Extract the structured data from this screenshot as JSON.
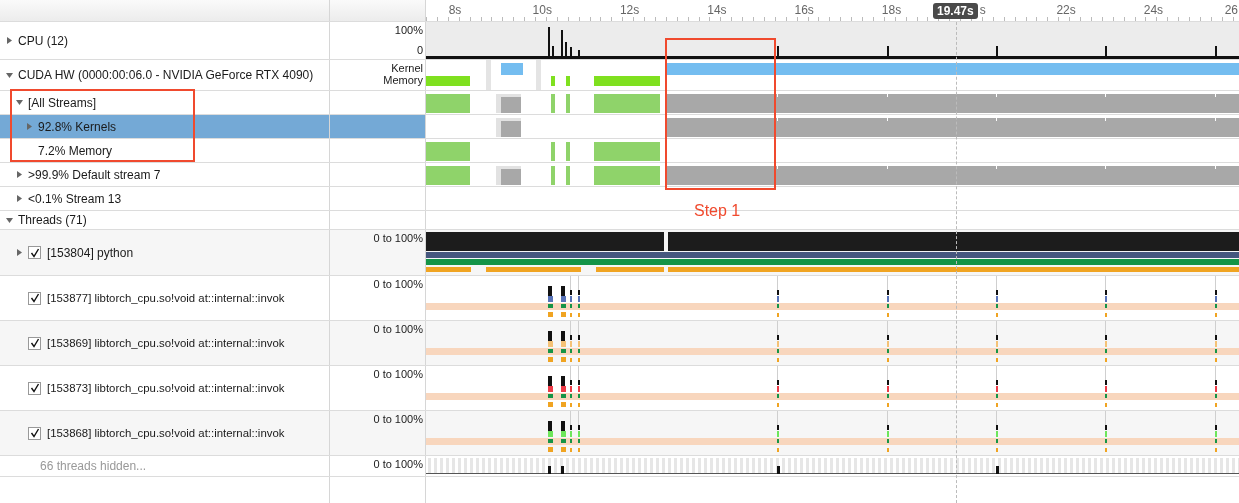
{
  "ruler": {
    "ticks": [
      "8s",
      "10s",
      "12s",
      "14s",
      "16s",
      "18s",
      "s",
      "22s",
      "24s",
      "26"
    ],
    "cursor": "19.47s"
  },
  "tree": [
    {
      "kind": "cpu",
      "label": "CPU (12)",
      "expanded": false,
      "selected": false,
      "scale": [
        "100%",
        "0"
      ]
    },
    {
      "kind": "gpu",
      "label": "CUDA HW (0000:00:06.0 - NVIDIA GeForce RTX 4090)",
      "expanded": true,
      "selected": false,
      "scale": [
        "Kernel",
        "Memory"
      ],
      "children": [
        {
          "kind": "stream",
          "label": "[All Streams]",
          "expanded": true,
          "selected": false,
          "children": [
            {
              "kind": "stream",
              "label": "92.8% Kernels",
              "expanded": false,
              "selected": true
            },
            {
              "kind": "stream",
              "label": "7.2% Memory",
              "selected": false
            }
          ]
        },
        {
          "kind": "stream",
          "label": ">99.9% Default stream 7",
          "expanded": false,
          "selected": false
        },
        {
          "kind": "stream",
          "label": "<0.1% Stream 13",
          "expanded": false,
          "selected": false
        }
      ]
    },
    {
      "kind": "section",
      "label": "Threads (71)",
      "expanded": true,
      "selected": false,
      "children": [
        {
          "kind": "process",
          "label": "[153804] python",
          "expanded": false,
          "checked": true,
          "selected": false,
          "scale": [
            "0 to 100%"
          ]
        },
        {
          "kind": "thread",
          "label": "[153877] libtorch_cpu.so!void at::internal::invok",
          "checked": true,
          "selected": false,
          "scale": [
            "0 to 100%"
          ]
        },
        {
          "kind": "thread",
          "label": "[153869] libtorch_cpu.so!void at::internal::invok",
          "checked": true,
          "selected": false,
          "scale": [
            "0 to 100%"
          ]
        },
        {
          "kind": "thread",
          "label": "[153873] libtorch_cpu.so!void at::internal::invok",
          "checked": true,
          "selected": false,
          "scale": [
            "0 to 100%"
          ]
        },
        {
          "kind": "thread",
          "label": "[153868] libtorch_cpu.so!void at::internal::invok",
          "checked": true,
          "selected": false,
          "scale": [
            "0 to 100%"
          ]
        },
        {
          "kind": "hidden",
          "label": "66 threads hidden...",
          "selected": false,
          "scale": [
            "0 to 100%"
          ]
        }
      ]
    }
  ],
  "annotation": {
    "text": "Step 1"
  }
}
